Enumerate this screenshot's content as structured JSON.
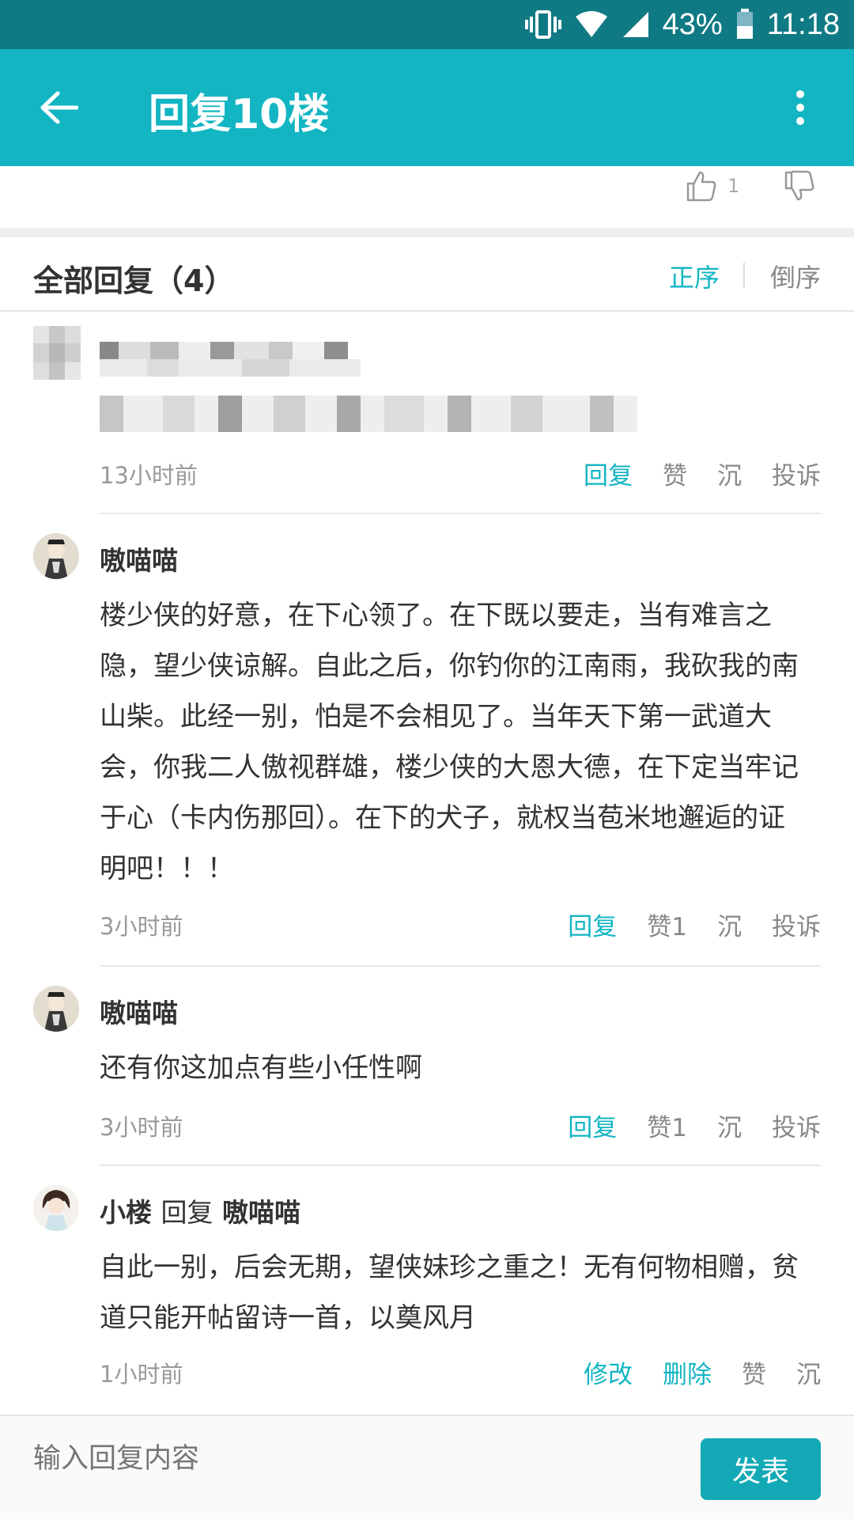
{
  "status_bar": {
    "battery": "43%",
    "time": "11:18"
  },
  "app_bar": {
    "title": "回复10楼"
  },
  "vote": {
    "like_count": "1"
  },
  "list_header": {
    "title": "全部回复（4）",
    "sort_asc": "正序",
    "sort_desc": "倒序"
  },
  "replies": [
    {
      "author": "",
      "content": "",
      "time": "13小时前",
      "actions": [
        "回复",
        "赞",
        "沉",
        "投诉"
      ]
    },
    {
      "author": "嗷喵喵",
      "content": "楼少侠的好意，在下心领了。在下既以要走，当有难言之隐，望少侠谅解。自此之后，你钓你的江南雨，我砍我的南山柴。此经一别，怕是不会相见了。当年天下第一武道大会，你我二人傲视群雄，楼少侠的大恩大德，在下定当牢记于心（卡内伤那回）。在下的犬子，就权当苞米地邂逅的证明吧！！！",
      "time": "3小时前",
      "actions": [
        "回复",
        "赞1",
        "沉",
        "投诉"
      ]
    },
    {
      "author": "嗷喵喵",
      "content": "还有你这加点有些小任性啊",
      "time": "3小时前",
      "actions": [
        "回复",
        "赞1",
        "沉",
        "投诉"
      ]
    },
    {
      "author": "小楼",
      "reply_word": "回复",
      "reply_to": "嗷喵喵",
      "content": "自此一别，后会无期，望侠妹珍之重之！无有何物相赠，贫道只能开帖留诗一首，以奠风月",
      "time": "1小时前",
      "actions": [
        "修改",
        "删除",
        "赞",
        "沉"
      ]
    }
  ],
  "composer": {
    "placeholder": "输入回复内容",
    "submit_label": "发表"
  },
  "colors": {
    "accent": "#13b5c3",
    "status_bar": "#107a84"
  }
}
